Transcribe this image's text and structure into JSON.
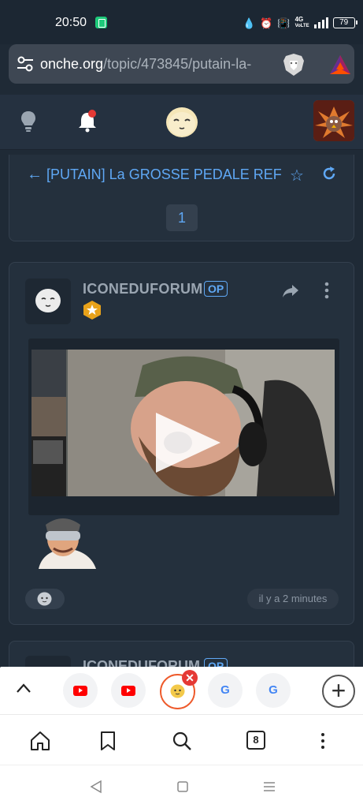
{
  "status_bar": {
    "time": "20:50",
    "network": "4G",
    "network_sub": "VoLTE",
    "battery": "79"
  },
  "browser": {
    "url_domain": "onche.org",
    "url_path": "/topic/473845/putain-la-",
    "tabs_count": "8"
  },
  "topic": {
    "title": "[PUTAIN] La GROSSE PEDALE REF",
    "current_page": "1"
  },
  "post": {
    "author": "ICONEDUFORUM",
    "author_badge": "OP",
    "timestamp": "il y a 2 minutes"
  },
  "next_post": {
    "author": "ICONEDUFORUM",
    "author_badge": "OP"
  },
  "tab_strip": {
    "tabs": [
      {
        "icon": "youtube-icon"
      },
      {
        "icon": "youtube-icon"
      },
      {
        "icon": "onche-face-icon",
        "active": true
      },
      {
        "icon": "google-icon",
        "label": "G"
      },
      {
        "icon": "google-icon",
        "label": "G"
      }
    ]
  },
  "colors": {
    "accent": "#5fa8f5",
    "background": "#1f2a36",
    "card": "#24303d",
    "active_tab_ring": "#ee5a2b",
    "notification_dot": "#e53935"
  }
}
